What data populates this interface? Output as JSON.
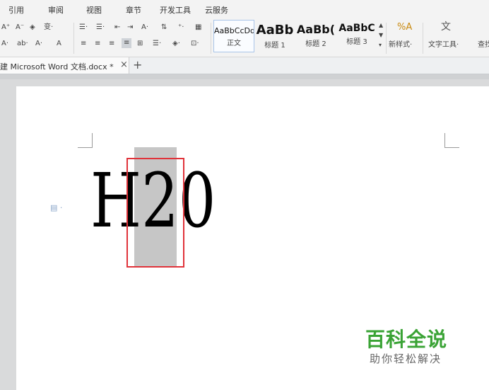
{
  "menu": [
    "引用",
    "审阅",
    "视图",
    "章节",
    "开发工具",
    "云服务"
  ],
  "ribbon": {
    "font_row": [
      "A⁺",
      "A⁻",
      "◈",
      "变·"
    ],
    "font_row2": [
      "A·",
      "ab·",
      "A·",
      "A"
    ],
    "para_row": [
      "☰·",
      "☰·",
      "⇤",
      "⇥",
      "A·",
      "⇅",
      "⁺·",
      "▦"
    ],
    "para_row2": [
      "≡",
      "≡",
      "≡",
      "≡",
      "⊞",
      "☰·",
      "◈·",
      "⊡·"
    ],
    "styles": [
      {
        "preview": "AaBbCcDd",
        "name": "正文"
      },
      {
        "preview": "AaBb",
        "name": "标题 1"
      },
      {
        "preview": "AaBb(",
        "name": "标题 2"
      },
      {
        "preview": "AaBbC",
        "name": "标题 3"
      }
    ],
    "new_style": "新样式·",
    "text_tool": "文字工具·",
    "find": "查找"
  },
  "tab": {
    "title": "建 Microsoft Word 文档.docx *",
    "close": "×",
    "add": "+"
  },
  "document": {
    "text": "H20"
  },
  "watermark": {
    "title": "百科全说",
    "subtitle": "助你轻松解决"
  },
  "colors": {
    "accent": "#3aa335",
    "selection_border": "#e0333a",
    "highlight": "#c6c6c6"
  }
}
